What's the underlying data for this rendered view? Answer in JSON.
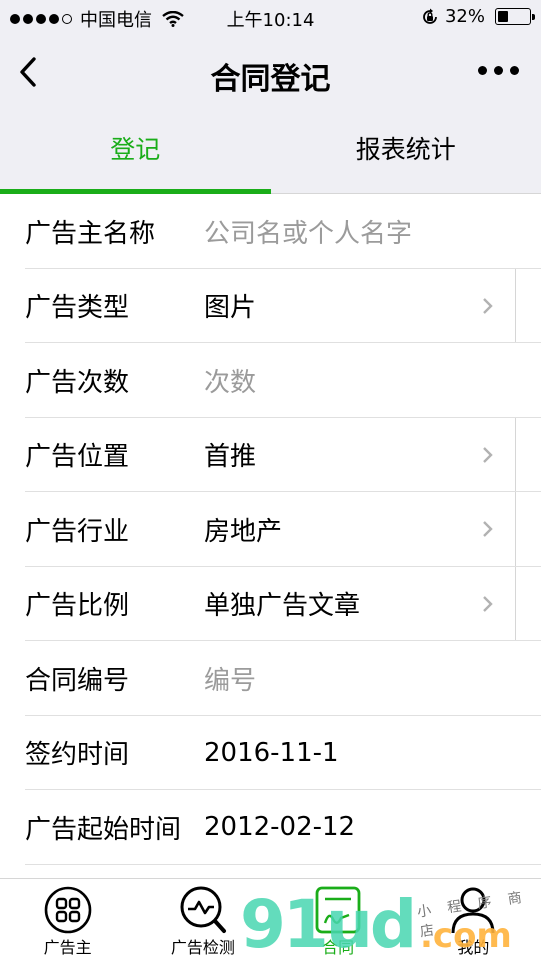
{
  "status_bar": {
    "carrier": "中国电信",
    "time": "上午10:14",
    "battery": "32%",
    "battery_level": 0.32,
    "icons": [
      "signal-dots",
      "wifi-icon",
      "rotation-lock-icon",
      "battery-icon"
    ]
  },
  "navbar": {
    "title": "合同登记",
    "back_icon": "chevron-left-icon",
    "more_icon": "more-dots-icon"
  },
  "tabs": [
    {
      "label": "登记",
      "active": true
    },
    {
      "label": "报表统计",
      "active": false
    }
  ],
  "form": {
    "rows": [
      {
        "label": "广告主名称",
        "value": "公司名或个人名字",
        "placeholder": true,
        "has_arrow": false
      },
      {
        "label": "广告类型",
        "value": "图片",
        "placeholder": false,
        "has_arrow": true
      },
      {
        "label": "广告次数",
        "value": "次数",
        "placeholder": true,
        "has_arrow": false
      },
      {
        "label": "广告位置",
        "value": "首推",
        "placeholder": false,
        "has_arrow": true
      },
      {
        "label": "广告行业",
        "value": "房地产",
        "placeholder": false,
        "has_arrow": true
      },
      {
        "label": "广告比例",
        "value": "单独广告文章",
        "placeholder": false,
        "has_arrow": true
      },
      {
        "label": "合同编号",
        "value": "编号",
        "placeholder": true,
        "has_arrow": false
      },
      {
        "label": "签约时间",
        "value": "2016-11-1",
        "placeholder": false,
        "has_arrow": false
      },
      {
        "label": "广告起始时间",
        "value": "2012-02-12",
        "placeholder": false,
        "has_arrow": false
      }
    ]
  },
  "tabbar": {
    "items": [
      {
        "label": "广告主",
        "icon": "grid-circle-icon",
        "active": false
      },
      {
        "label": "广告检测",
        "icon": "search-wave-icon",
        "active": false
      },
      {
        "label": "合同",
        "icon": "contract-icon",
        "active": true
      },
      {
        "label": "我的",
        "icon": "user-icon",
        "active": false
      }
    ]
  },
  "watermark": {
    "text": "91ud",
    "suffix": ".com",
    "tagline": "小 程 序 商 店"
  },
  "colors": {
    "accent": "#1aad19",
    "nav_background": "#efeff4",
    "placeholder": "#9b9b9b"
  }
}
